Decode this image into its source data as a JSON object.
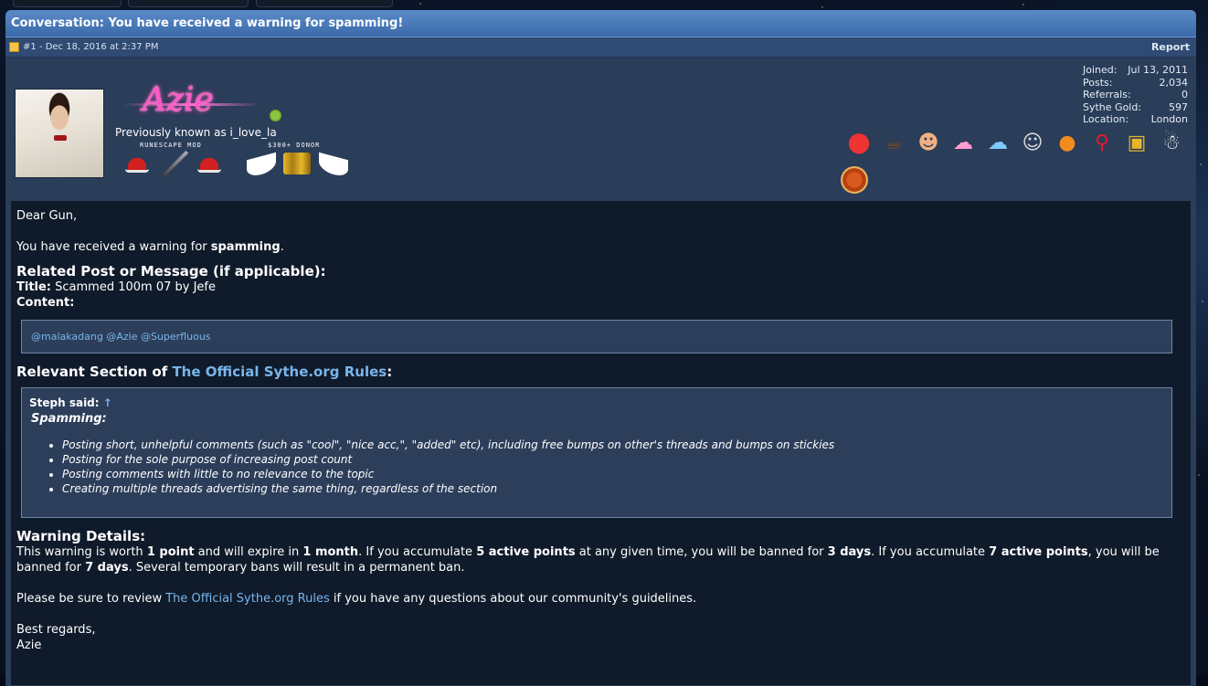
{
  "thread": {
    "title": "Conversation: You have received a warning for spamming!",
    "post_meta": "#1 - Dec 18, 2016 at 2:37 PM",
    "report_label": "Report"
  },
  "user": {
    "name": "Azie",
    "previously_known": "Previously known as i_love_la",
    "rank_left": "RUNESCAPE MOD",
    "rank_right": "$300+ DONOR",
    "online_color": "#8cc63f",
    "stats": [
      {
        "label": "Joined:",
        "value": "Jul 13, 2011"
      },
      {
        "label": "Posts:",
        "value": "2,034"
      },
      {
        "label": "Referrals:",
        "value": "0"
      },
      {
        "label": "Sythe Gold:",
        "value": "597"
      },
      {
        "label": "Location:",
        "value": "London"
      }
    ],
    "award_icons": [
      "mushroom-icon",
      "beer-mug-icon",
      "face-icon",
      "pink-pony-icon",
      "rainbow-pony-icon",
      "portrait-icon",
      "pumpkin-icon",
      "ribbon-icon",
      "lock-icon",
      "santa-icon",
      "pizza-icon"
    ]
  },
  "message": {
    "greeting": "Dear Gun,",
    "warning_intro_pre": "You have received a warning for ",
    "warning_reason": "spamming",
    "warning_intro_post": ".",
    "related_heading": "Related Post or Message (if applicable):",
    "title_label": "Title:",
    "title_value": " Scammed 100m 07 by Jefe",
    "content_label": "Content:",
    "content_text": "@malakadang @Azie @Superfluous",
    "section_heading_pre": "Relevant Section of ",
    "section_heading_link": "The Official Sythe.org Rules",
    "section_heading_post": ":",
    "quote_author": "Steph said:",
    "quote_arrow": "↑",
    "quote_topic": "Spamming:",
    "rules": [
      "Posting short, unhelpful comments (such as \"cool\", \"nice acc,\", \"added\" etc), including free bumps on other's threads and bumps on stickies",
      "Posting for the sole purpose of increasing post count",
      "Posting comments with little to no relevance to the topic",
      "Creating multiple threads advertising the same thing, regardless of the section"
    ],
    "details_heading": "Warning Details:",
    "details": {
      "t1": "This warning is worth ",
      "b1": "1 point",
      "t2": " and will expire in ",
      "b2": "1 month",
      "t3": ". If you accumulate ",
      "b3": "5 active points",
      "t4": " at any given time, you will be banned for ",
      "b4": "3 days",
      "t5": ". If you accumulate ",
      "b5": "7 active points",
      "t6": ", you will be banned for ",
      "b6": "7 days",
      "t7": ". Several temporary bans will result in a permanent ban."
    },
    "review_pre": "Please be sure to review ",
    "review_link": "The Official Sythe.org Rules",
    "review_post": " if you have any questions about our community's guidelines.",
    "closing": "Best regards,",
    "signature": "Azie"
  }
}
